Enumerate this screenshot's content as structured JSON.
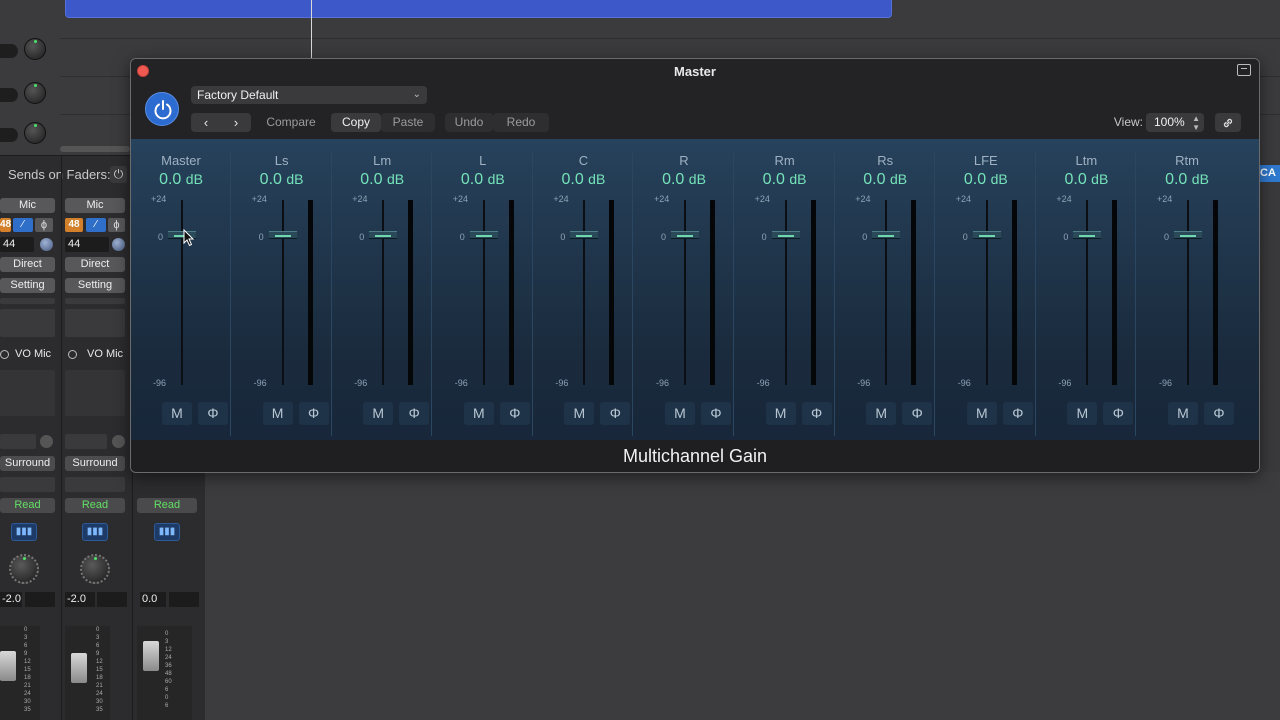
{
  "plugin": {
    "title": "Master",
    "preset": "Factory Default",
    "toolbar": {
      "back": "‹",
      "forward": "›",
      "compare": "Compare",
      "copy": "Copy",
      "paste": "Paste",
      "undo": "Undo",
      "redo": "Redo",
      "view_label": "View:",
      "view_value": "100%"
    },
    "plugin_name": "Multichannel Gain",
    "scale": {
      "top": "+24",
      "zero": "0",
      "bottom": "-96"
    },
    "button_labels": {
      "mute": "M",
      "phase": "Φ"
    },
    "unit": "dB",
    "channels": [
      {
        "name": "Master",
        "value": "0.0",
        "has_meter": false
      },
      {
        "name": "Ls",
        "value": "0.0",
        "has_meter": true
      },
      {
        "name": "Lm",
        "value": "0.0",
        "has_meter": true
      },
      {
        "name": "L",
        "value": "0.0",
        "has_meter": true
      },
      {
        "name": "C",
        "value": "0.0",
        "has_meter": true
      },
      {
        "name": "R",
        "value": "0.0",
        "has_meter": true
      },
      {
        "name": "Rm",
        "value": "0.0",
        "has_meter": true
      },
      {
        "name": "Rs",
        "value": "0.0",
        "has_meter": true
      },
      {
        "name": "LFE",
        "value": "0.0",
        "has_meter": true
      },
      {
        "name": "Ltm",
        "value": "0.0",
        "has_meter": true
      },
      {
        "name": "Rtm",
        "value": "0.0",
        "has_meter": true
      }
    ]
  },
  "mixer": {
    "sends_on_faders": "Sends on Faders:",
    "edge_badge": "CA",
    "strips": [
      {
        "input": "Mic",
        "format_num": "48",
        "gain": "44",
        "mode": "Direct",
        "setting": "Setting",
        "output": "VO Mic",
        "pan_mode": "Surround",
        "automation": "Read",
        "volume": "-2.0"
      },
      {
        "input": "Mic",
        "format_num": "48",
        "gain": "44",
        "mode": "Direct",
        "setting": "Setting",
        "output": "VO Mic",
        "pan_mode": "Surround",
        "automation": "Read",
        "volume": "-2.0"
      },
      {
        "automation": "Read",
        "volume": "0.0"
      }
    ],
    "fader_scale": [
      "0",
      "3",
      "6",
      "9",
      "12",
      "15",
      "18",
      "21",
      "24",
      "30",
      "35"
    ],
    "fader_scale_master": [
      "0",
      "3",
      "12",
      "24",
      "36",
      "48",
      "60",
      "6",
      "0",
      "6"
    ]
  },
  "colors": {
    "accent_blue": "#2c6bd0",
    "value_green": "#75e3b9",
    "read_green": "#62e064",
    "close_red": "#ee5a52",
    "region_blue": "#3d58c8"
  }
}
